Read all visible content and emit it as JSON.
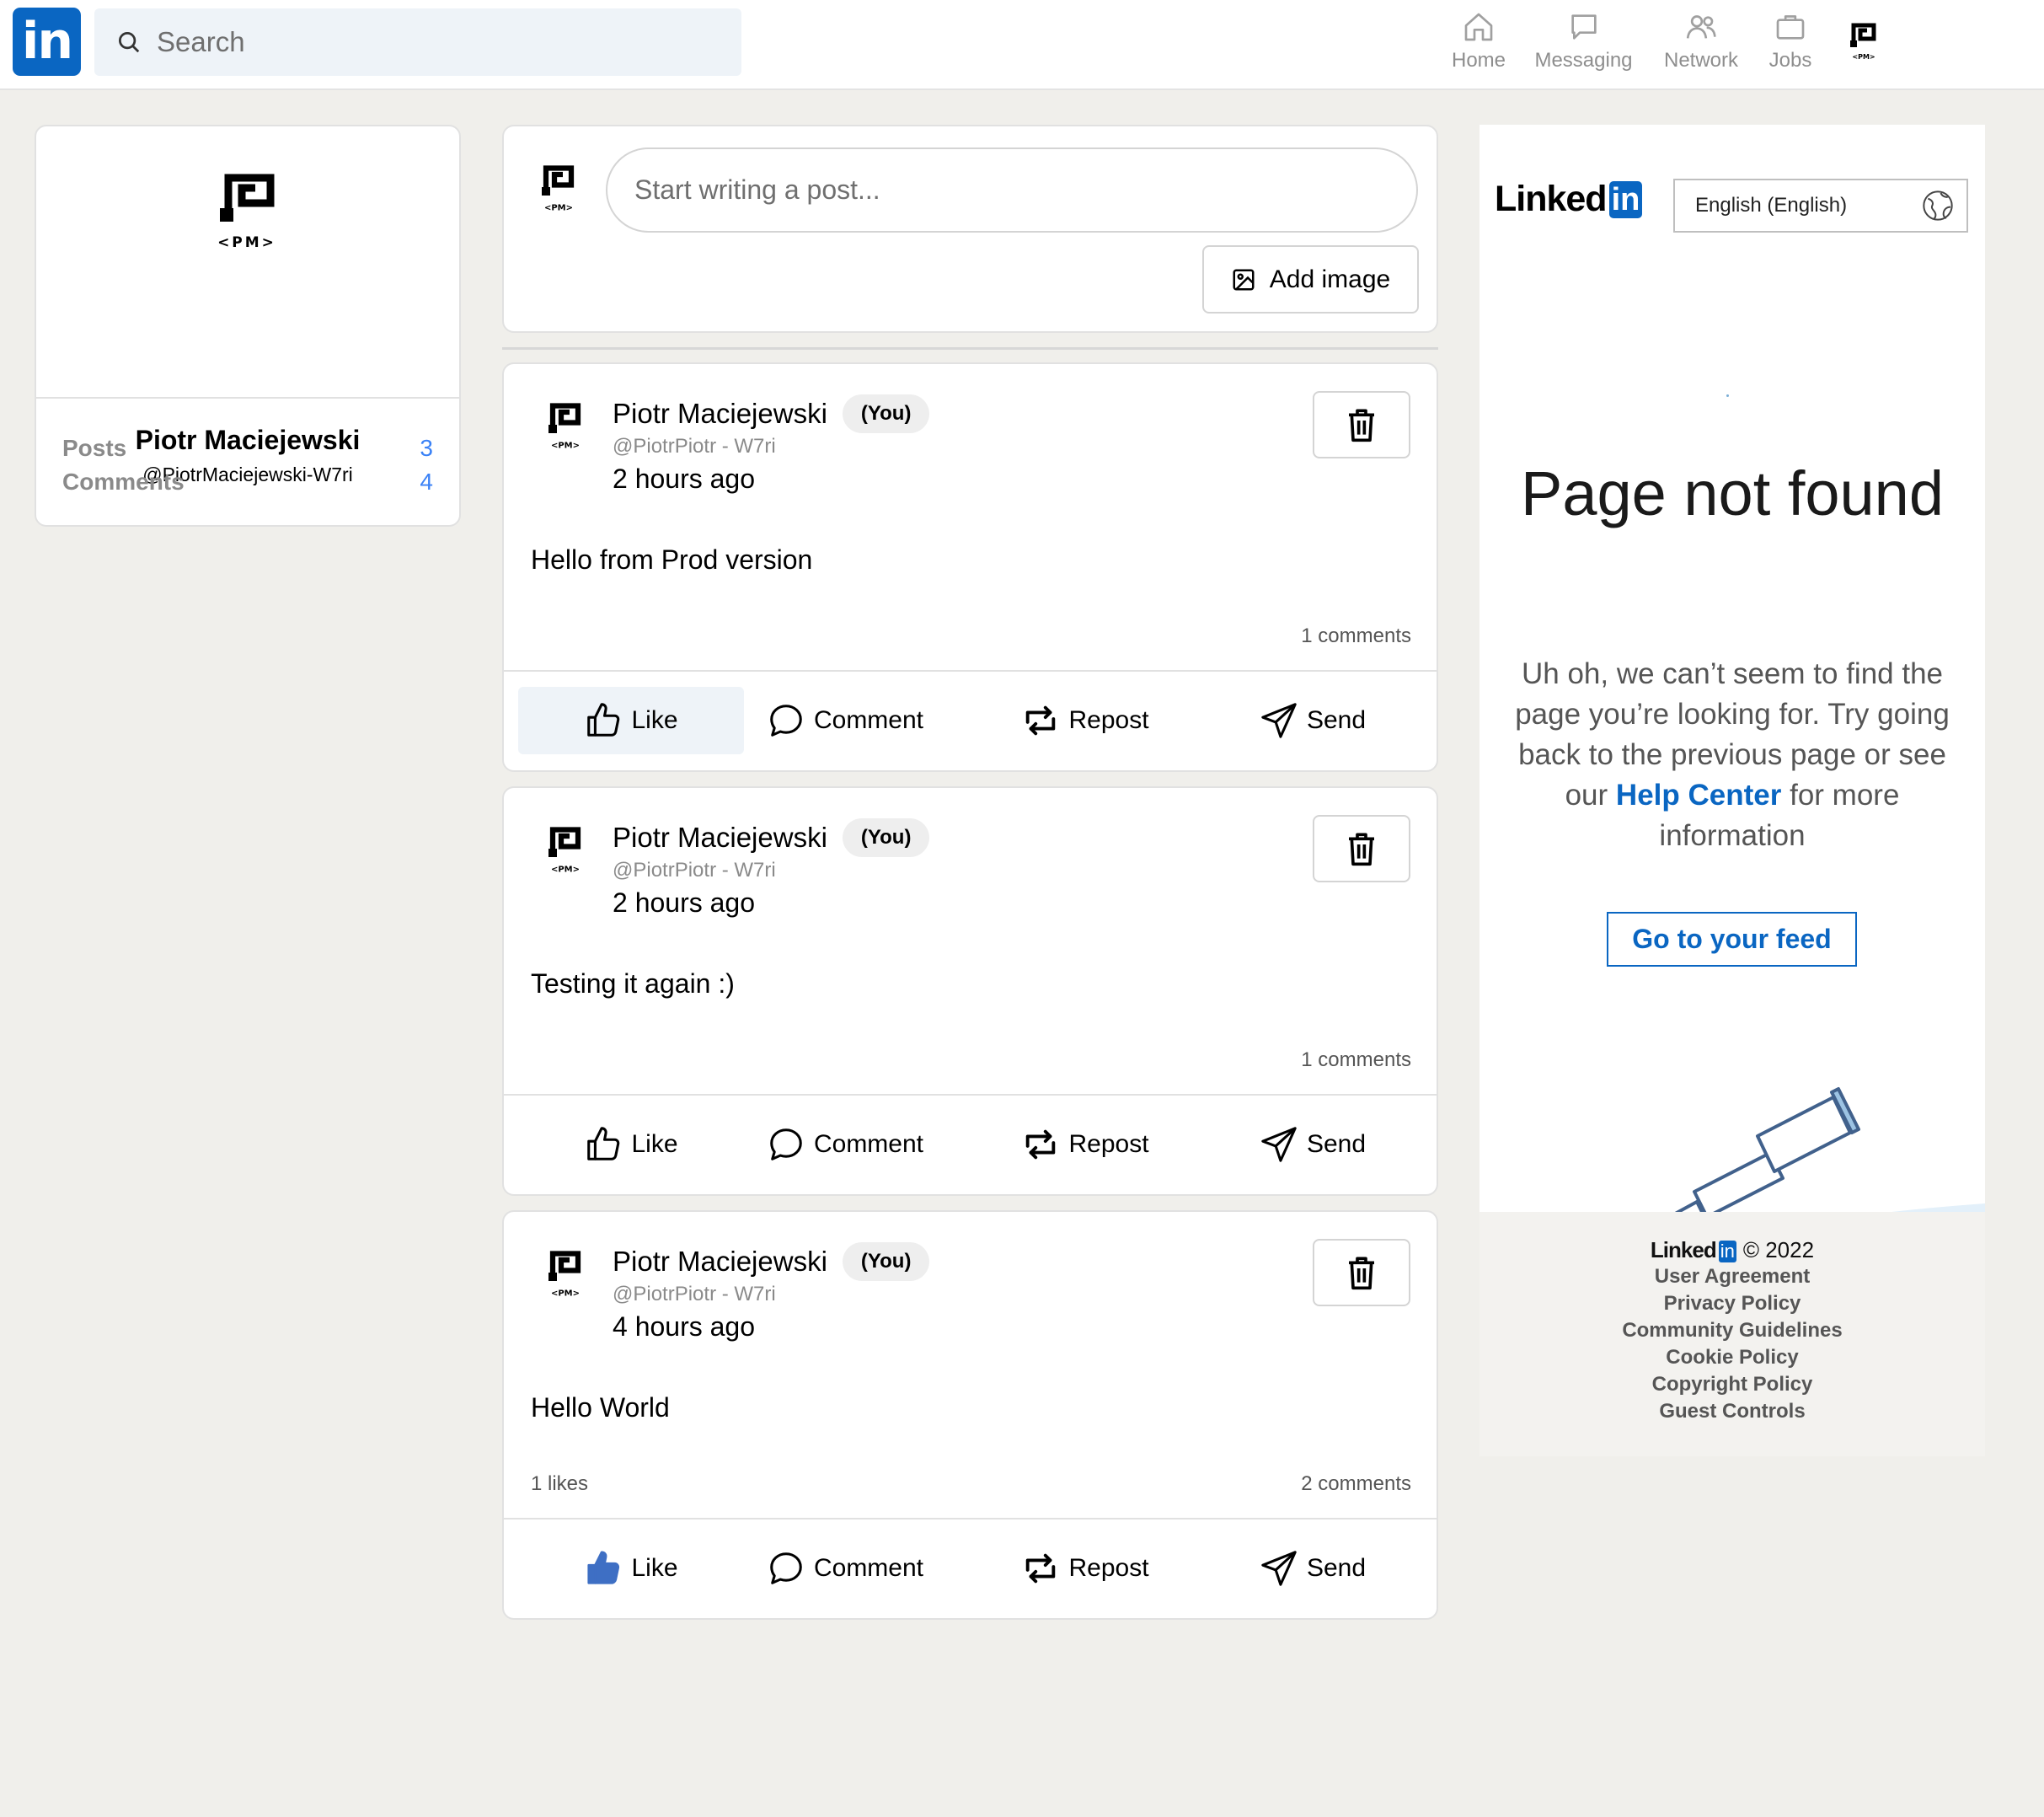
{
  "nav": {
    "logo": "in",
    "search_placeholder": "Search",
    "items": [
      {
        "label": "Home",
        "icon": "home-icon"
      },
      {
        "label": "Messaging",
        "icon": "messaging-icon"
      },
      {
        "label": "Network",
        "icon": "network-icon"
      },
      {
        "label": "Jobs",
        "icon": "jobs-icon"
      }
    ],
    "me_icon": "pm-avatar-icon"
  },
  "avatar_text": "<PM>",
  "profile": {
    "name": "Piotr Maciejewski",
    "handle": "@PiotrMaciejewski-W7ri",
    "stats": [
      {
        "label": "Posts",
        "value": "3"
      },
      {
        "label": "Comments",
        "value": "4"
      }
    ]
  },
  "composer": {
    "placeholder": "Start writing a post...",
    "add_image_label": "Add image"
  },
  "posts": [
    {
      "author": "Piotr Maciejewski",
      "badge": "(You)",
      "handle": "@PiotrPiotr - W7ri",
      "time": "2 hours ago",
      "body": "Hello from Prod version",
      "likes": "",
      "comments": "1 comments",
      "liked": false
    },
    {
      "author": "Piotr Maciejewski",
      "badge": "(You)",
      "handle": "@PiotrPiotr - W7ri",
      "time": "2 hours ago",
      "body": "Testing it again :)",
      "likes": "",
      "comments": "1 comments",
      "liked": false
    },
    {
      "author": "Piotr Maciejewski",
      "badge": "(You)",
      "handle": "@PiotrPiotr - W7ri",
      "time": "4 hours ago",
      "body": "Hello World",
      "likes": "1 likes",
      "comments": "2 comments",
      "liked": true
    }
  ],
  "actions": {
    "like": "Like",
    "comment": "Comment",
    "repost": "Repost",
    "send": "Send"
  },
  "right": {
    "brand_text": "Linked",
    "brand_box": "in",
    "language": "English (English)",
    "title": "Page not found",
    "message_before": "Uh oh, we can’t seem to find the page you’re looking for. Try going back to the previous page or see our",
    "help_link": "Help Center",
    "message_after": "for more information",
    "feed_button": "Go to your feed",
    "footer": {
      "year": "© 2022",
      "links": [
        "User Agreement",
        "Privacy Policy",
        "Community Guidelines",
        "Cookie Policy",
        "Copyright Policy",
        "Guest Controls"
      ]
    }
  },
  "colors": {
    "brand": "#0a66c2",
    "like_active": "#3e6fc4",
    "stat_value": "#3b82f6",
    "page_bg": "#f0efeb"
  }
}
